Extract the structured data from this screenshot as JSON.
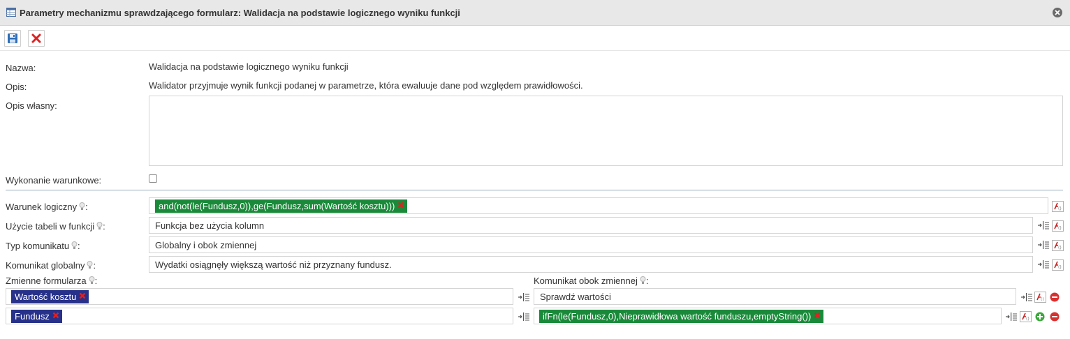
{
  "window": {
    "title": "Parametry mechanizmu sprawdzającego formularz: Walidacja na podstawie logicznego wyniku funkcji"
  },
  "toolbar": {
    "save_icon": "save-icon",
    "cancel_icon": "cancel-icon"
  },
  "form": {
    "name_label": "Nazwa:",
    "name_value": "Walidacja na podstawie logicznego wyniku funkcji",
    "desc_label": "Opis:",
    "desc_value": "Walidator przyjmuje wynik funkcji podanej w parametrze, która ewaluuje dane pod względem prawidłowości.",
    "own_desc_label": "Opis własny:",
    "own_desc_value": "",
    "conditional_label": "Wykonanie warunkowe:",
    "conditional_checked": false
  },
  "params": {
    "logic_label": "Warunek logiczny",
    "logic_value": "and(not(le(Fundusz,0)),ge(Fundusz,sum(Wartość kosztu)))",
    "table_use_label": "Użycie tabeli w funkcji",
    "table_use_value": "Funkcja bez użycia kolumn",
    "msg_type_label": "Typ komunikatu",
    "msg_type_value": "Globalny i obok zmiennej",
    "global_msg_label": "Komunikat globalny",
    "global_msg_value": "Wydatki osiągnęły większą wartość niż przyznany fundusz.",
    "vars_label": "Zmienne formularza",
    "near_msg_label": "Komunikat obok zmiennej",
    "colon": ":",
    "rows": [
      {
        "variable": "Wartość kosztu",
        "message": "Sprawdź wartości",
        "message_is_function": false
      },
      {
        "variable": "Fundusz",
        "message": "ifFn(le(Fundusz,0),Nieprawidłowa wartość funduszu,emptyString())",
        "message_is_function": true
      }
    ]
  },
  "colors": {
    "function_chip": "#1a8a3a",
    "variable_chip": "#27318a",
    "remove_x": "#e02020"
  }
}
